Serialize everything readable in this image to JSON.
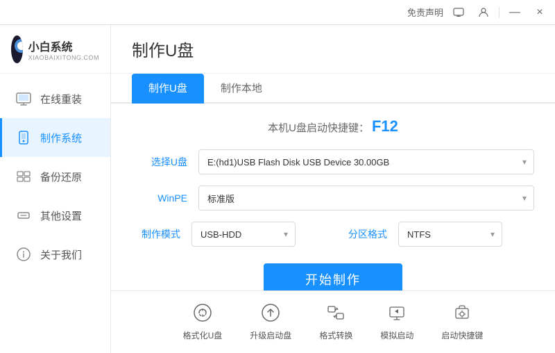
{
  "titleBar": {
    "mianSheng": "免责声明",
    "minimizeLabel": "—",
    "closeLabel": "×",
    "icon1": "📋",
    "icon2": "👤"
  },
  "logo": {
    "title": "小白系统",
    "subtitle": "XIAOBAIXITONG.COM"
  },
  "sidebar": {
    "items": [
      {
        "label": "在线重装",
        "icon": "🖥",
        "active": false
      },
      {
        "label": "制作系统",
        "icon": "💾",
        "active": true
      },
      {
        "label": "备份还原",
        "icon": "📋",
        "active": false
      },
      {
        "label": "其他设置",
        "icon": "🔒",
        "active": false
      },
      {
        "label": "关于我们",
        "icon": "ℹ",
        "active": false
      }
    ]
  },
  "page": {
    "title": "制作U盘",
    "tabs": [
      {
        "label": "制作U盘",
        "active": true
      },
      {
        "label": "制作本地",
        "active": false
      }
    ],
    "shortcutHint": "本机U盘启动快捷键：",
    "shortcutKey": "F12",
    "form": {
      "usbLabel": "选择U盘",
      "usbValue": "E:(hd1)USB Flash Disk USB Device 30.00GB",
      "winpeLabel": "WinPE",
      "winpeValue": "标准版",
      "modeLabel": "制作模式",
      "modeValue": "USB-HDD",
      "partLabel": "分区格式",
      "partValue": "NTFS",
      "startBtn": "开始制作"
    }
  },
  "bottomToolbar": {
    "items": [
      {
        "label": "格式化U盘",
        "icon": "format"
      },
      {
        "label": "升级启动盘",
        "icon": "upgrade"
      },
      {
        "label": "格式转换",
        "icon": "convert"
      },
      {
        "label": "模拟启动",
        "icon": "simulate"
      },
      {
        "label": "启动快捷键",
        "icon": "shortcut"
      }
    ]
  }
}
